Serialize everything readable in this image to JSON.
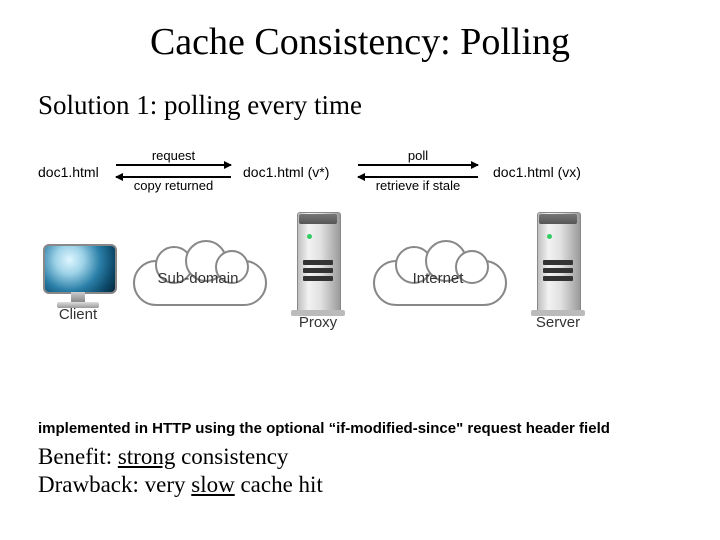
{
  "title": "Cache Consistency: Polling",
  "subtitle": "Solution 1: polling every time",
  "diagram": {
    "labels": {
      "doc_left": "doc1.html",
      "doc_mid": "doc1.html (v*)",
      "doc_right": "doc1.html (vx)"
    },
    "arrows": {
      "left_top": "request",
      "left_bottom": "copy returned",
      "right_top": "poll",
      "right_bottom": "retrieve if stale"
    },
    "nodes": {
      "client": "Client",
      "subdomain": "Sub-domain",
      "proxy": "Proxy",
      "internet": "Internet",
      "server": "Server"
    }
  },
  "note": "implemented in HTTP using the optional “if-modified-since\" request header field",
  "benefit_label": "Benefit: ",
  "benefit_word": "strong",
  "benefit_rest": " consistency",
  "drawback_label": "Drawback: very ",
  "drawback_word": "slow",
  "drawback_rest": " cache hit"
}
